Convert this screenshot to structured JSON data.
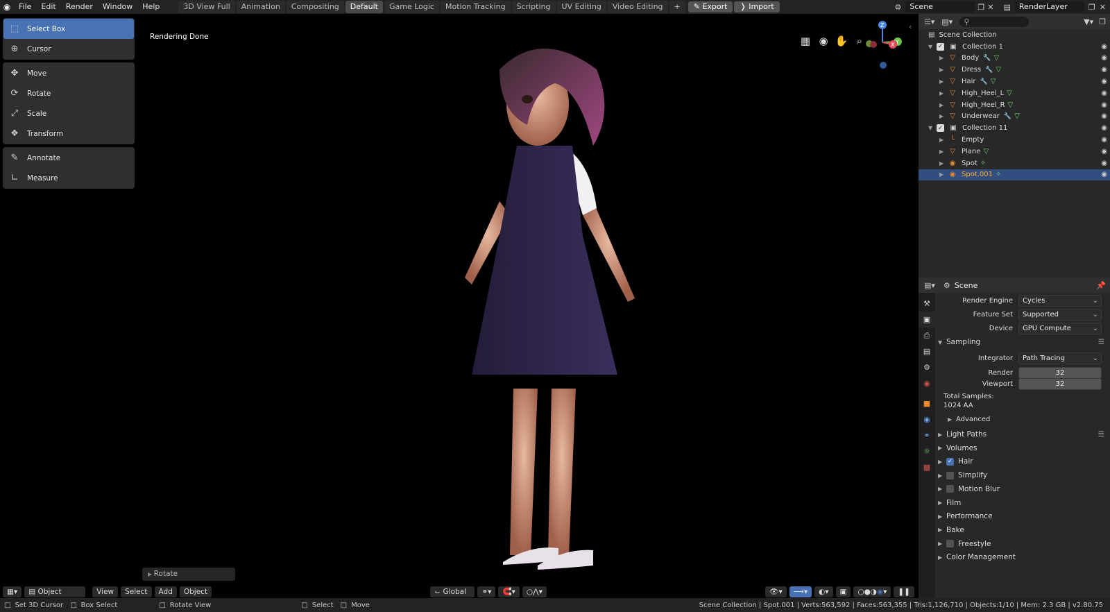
{
  "menu": [
    "File",
    "Edit",
    "Render",
    "Window",
    "Help"
  ],
  "workspaces": [
    {
      "label": "3D View Full",
      "active": false
    },
    {
      "label": "Animation",
      "active": false
    },
    {
      "label": "Compositing",
      "active": false
    },
    {
      "label": "Default",
      "active": true
    },
    {
      "label": "Game Logic",
      "active": false
    },
    {
      "label": "Motion Tracking",
      "active": false
    },
    {
      "label": "Scripting",
      "active": false
    },
    {
      "label": "UV Editing",
      "active": false
    },
    {
      "label": "Video Editing",
      "active": false
    }
  ],
  "topbar": {
    "add_tab": "+",
    "export_label": "Export",
    "import_label": "Import",
    "scene_name": "Scene",
    "render_layer": "RenderLayer"
  },
  "tools": {
    "select_box": "Select Box",
    "cursor": "Cursor",
    "move": "Move",
    "rotate": "Rotate",
    "scale": "Scale",
    "transform": "Transform",
    "annotate": "Annotate",
    "measure": "Measure"
  },
  "viewport": {
    "status": "Rendering Done",
    "last_op": "Rotate",
    "mode": "Object Mode",
    "menus": [
      "View",
      "Select",
      "Add",
      "Object"
    ],
    "orientation": "Global",
    "gizmo": {
      "z": "Z",
      "y": "Y",
      "x": "X"
    }
  },
  "outliner": {
    "root": "Scene Collection",
    "rows": [
      {
        "label": "Collection 1",
        "type": "collection",
        "indent": 1,
        "mods": false,
        "mesh": false
      },
      {
        "label": "Body",
        "type": "mesh",
        "indent": 2,
        "mods": true,
        "mesh": true
      },
      {
        "label": "Dress",
        "type": "mesh",
        "indent": 2,
        "mods": true,
        "mesh": true
      },
      {
        "label": "Hair",
        "type": "mesh",
        "indent": 2,
        "mods": true,
        "mesh": true
      },
      {
        "label": "High_Heel_L",
        "type": "mesh",
        "indent": 2,
        "mods": false,
        "mesh": true
      },
      {
        "label": "High_Heel_R",
        "type": "mesh",
        "indent": 2,
        "mods": false,
        "mesh": true
      },
      {
        "label": "Underwear",
        "type": "mesh",
        "indent": 2,
        "mods": true,
        "mesh": true
      },
      {
        "label": "Collection 11",
        "type": "collection",
        "indent": 1,
        "mods": false,
        "mesh": false
      },
      {
        "label": "Empty",
        "type": "empty",
        "indent": 2,
        "mods": false,
        "mesh": false
      },
      {
        "label": "Plane",
        "type": "mesh",
        "indent": 2,
        "mods": false,
        "mesh": true
      },
      {
        "label": "Spot",
        "type": "light",
        "indent": 2,
        "mods": false,
        "mesh": false
      },
      {
        "label": "Spot.001",
        "type": "light",
        "indent": 2,
        "mods": false,
        "mesh": false,
        "selected": true
      }
    ]
  },
  "properties": {
    "context": "Scene",
    "render_engine_label": "Render Engine",
    "render_engine": "Cycles",
    "feature_set_label": "Feature Set",
    "feature_set": "Supported",
    "device_label": "Device",
    "device": "GPU Compute",
    "sampling": "Sampling",
    "integrator_label": "Integrator",
    "integrator": "Path Tracing",
    "render_label": "Render",
    "render_samples": "32",
    "viewport_label": "Viewport",
    "viewport_samples": "32",
    "total_samples_label": "Total Samples:",
    "total_samples": "1024 AA",
    "advanced": "Advanced",
    "panels": [
      {
        "label": "Light Paths",
        "checkbox": null
      },
      {
        "label": "Volumes",
        "checkbox": null
      },
      {
        "label": "Hair",
        "checkbox": true
      },
      {
        "label": "Simplify",
        "checkbox": false
      },
      {
        "label": "Motion Blur",
        "checkbox": false
      },
      {
        "label": "Film",
        "checkbox": null
      },
      {
        "label": "Performance",
        "checkbox": null
      },
      {
        "label": "Bake",
        "checkbox": null
      },
      {
        "label": "Freestyle",
        "checkbox": false
      },
      {
        "label": "Color Management",
        "checkbox": null
      }
    ]
  },
  "statusbar": {
    "set_cursor": "Set 3D Cursor",
    "box_select": "Box Select",
    "rotate_view": "Rotate View",
    "select": "Select",
    "move": "Move",
    "info": "Scene Collection | Spot.001 | Verts:563,592 | Faces:563,355 | Tris:1,126,710 | Objects:1/10 | Mem: 2.3 GB | v2.80.75"
  },
  "colors": {
    "accent": "#4772b3",
    "selected_row": "#334d80",
    "panel": "#282828",
    "header": "#232323"
  }
}
